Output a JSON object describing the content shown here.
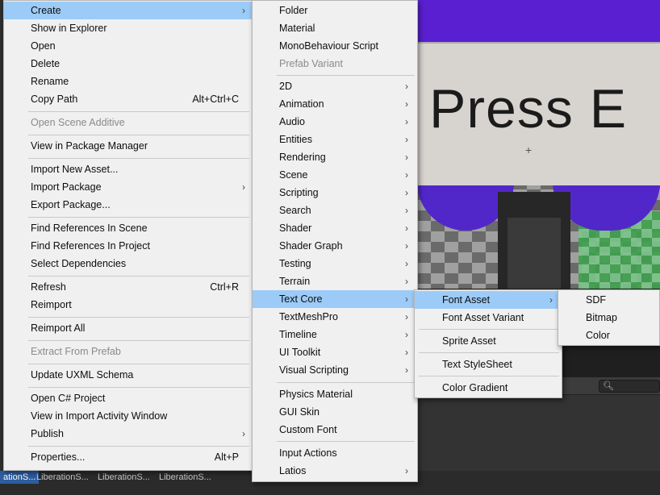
{
  "scene": {
    "sign_text": "Press E"
  },
  "search": {
    "icon": "search-icon"
  },
  "bottom_tabs": [
    "ationS...",
    "LiberationS...",
    "LiberationS...",
    "LiberationS..."
  ],
  "menu_main": [
    {
      "label": "Create",
      "submenu": true,
      "highlighted": true
    },
    {
      "label": "Show in Explorer"
    },
    {
      "label": "Open"
    },
    {
      "label": "Delete"
    },
    {
      "label": "Rename"
    },
    {
      "label": "Copy Path",
      "shortcut": "Alt+Ctrl+C"
    },
    {
      "label": "Open Scene Additive",
      "disabled": true
    },
    {
      "label": "View in Package Manager"
    },
    {
      "label": "Import New Asset..."
    },
    {
      "label": "Import Package",
      "submenu": true
    },
    {
      "label": "Export Package..."
    },
    {
      "label": "Find References In Scene"
    },
    {
      "label": "Find References In Project"
    },
    {
      "label": "Select Dependencies"
    },
    {
      "label": "Refresh",
      "shortcut": "Ctrl+R"
    },
    {
      "label": "Reimport"
    },
    {
      "label": "Reimport All"
    },
    {
      "label": "Extract From Prefab",
      "disabled": true
    },
    {
      "label": "Update UXML Schema"
    },
    {
      "label": "Open C# Project"
    },
    {
      "label": "View in Import Activity Window"
    },
    {
      "label": "Publish",
      "submenu": true
    },
    {
      "label": "Properties...",
      "shortcut": "Alt+P"
    }
  ],
  "menu_create": [
    {
      "label": "Folder"
    },
    {
      "label": "Material"
    },
    {
      "label": "MonoBehaviour Script"
    },
    {
      "label": "Prefab Variant",
      "disabled": true
    },
    {
      "label": "2D",
      "submenu": true
    },
    {
      "label": "Animation",
      "submenu": true
    },
    {
      "label": "Audio",
      "submenu": true
    },
    {
      "label": "Entities",
      "submenu": true
    },
    {
      "label": "Rendering",
      "submenu": true
    },
    {
      "label": "Scene",
      "submenu": true
    },
    {
      "label": "Scripting",
      "submenu": true
    },
    {
      "label": "Search",
      "submenu": true
    },
    {
      "label": "Shader",
      "submenu": true
    },
    {
      "label": "Shader Graph",
      "submenu": true
    },
    {
      "label": "Testing",
      "submenu": true
    },
    {
      "label": "Terrain",
      "submenu": true
    },
    {
      "label": "Text Core",
      "submenu": true,
      "highlighted": true
    },
    {
      "label": "TextMeshPro",
      "submenu": true
    },
    {
      "label": "Timeline",
      "submenu": true
    },
    {
      "label": "UI Toolkit",
      "submenu": true
    },
    {
      "label": "Visual Scripting",
      "submenu": true
    },
    {
      "label": "Physics Material"
    },
    {
      "label": "GUI Skin"
    },
    {
      "label": "Custom Font"
    },
    {
      "label": "Input Actions"
    },
    {
      "label": "Latios",
      "submenu": true
    }
  ],
  "menu_textcore": [
    {
      "label": "Font Asset",
      "submenu": true,
      "highlighted": true
    },
    {
      "label": "Font Asset Variant"
    },
    {
      "label": "Sprite Asset"
    },
    {
      "label": "Text StyleSheet"
    },
    {
      "label": "Color Gradient"
    }
  ],
  "menu_fontasset": [
    {
      "label": "SDF"
    },
    {
      "label": "Bitmap"
    },
    {
      "label": "Color"
    }
  ]
}
